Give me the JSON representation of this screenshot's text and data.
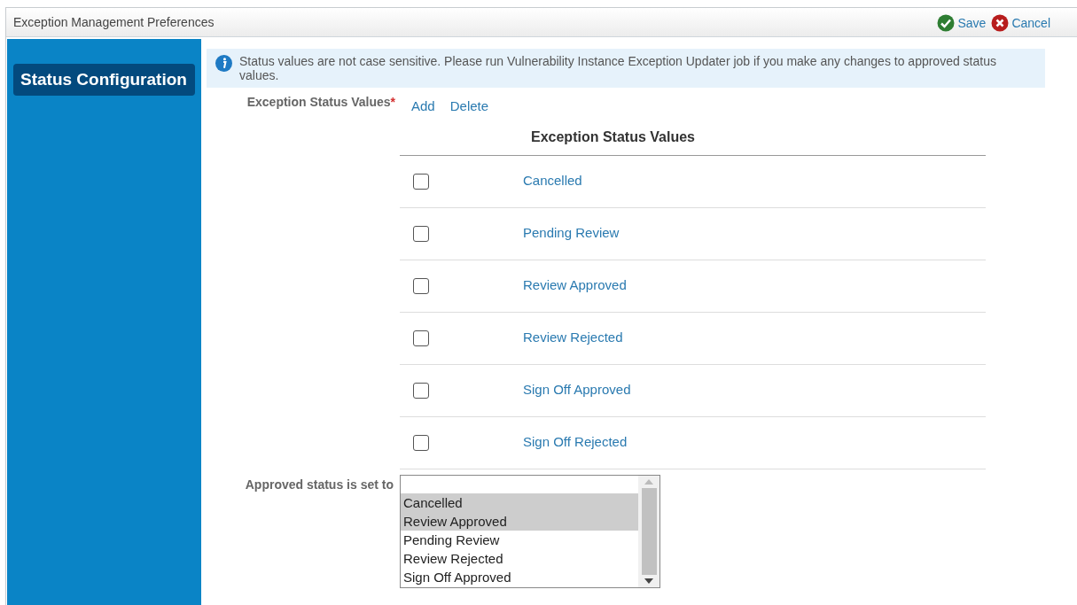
{
  "window": {
    "title": "Exception Management Preferences"
  },
  "toolbar": [
    {
      "kind": "save",
      "label": "Save"
    },
    {
      "kind": "cancel",
      "label": "Cancel"
    }
  ],
  "sidebar": {
    "items": [
      {
        "label": "Status Configuration",
        "selected": true
      }
    ]
  },
  "info": {
    "text": "Status values are not case sensitive. Please run Vulnerability Instance Exception Updater job if you make any changes to approved status values."
  },
  "status_values": {
    "label": "Exception Status Values",
    "required_mark": "*",
    "actions": [
      "Add",
      "Delete"
    ],
    "column": "Exception Status Values",
    "rows": [
      {
        "value": "Cancelled",
        "checked": false
      },
      {
        "value": "Pending Review",
        "checked": false
      },
      {
        "value": "Review Approved",
        "checked": false
      },
      {
        "value": "Review Rejected",
        "checked": false
      },
      {
        "value": "Sign Off Approved",
        "checked": false
      },
      {
        "value": "Sign Off Rejected",
        "checked": false
      }
    ]
  },
  "approved_status": {
    "label": "Approved status is set to",
    "options": [
      {
        "label": "Cancelled",
        "selected": true
      },
      {
        "label": "Review Approved",
        "selected": true
      },
      {
        "label": "Pending Review",
        "selected": false
      },
      {
        "label": "Review Rejected",
        "selected": false
      },
      {
        "label": "Sign Off Approved",
        "selected": false
      }
    ]
  }
}
